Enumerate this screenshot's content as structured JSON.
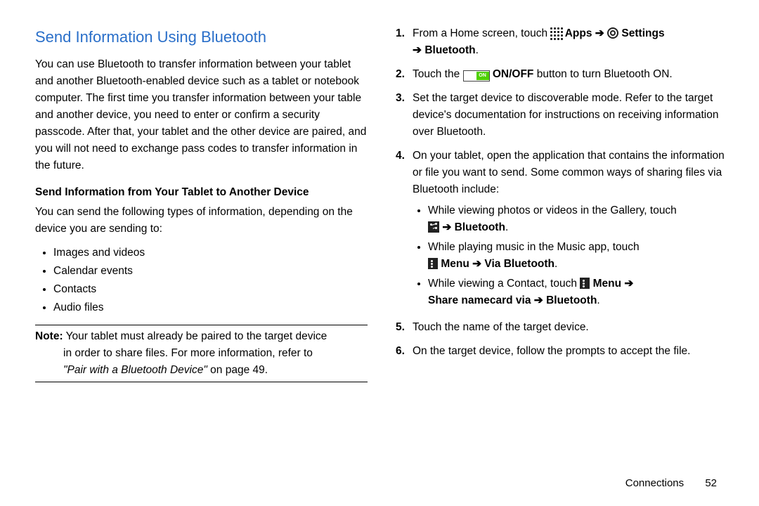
{
  "left": {
    "heading": "Send Information Using Bluetooth",
    "intro": "You can use Bluetooth to transfer information between your tablet and another Bluetooth-enabled device such as a tablet or notebook computer. The first time you transfer information between your table and another device, you need to enter or confirm a security passcode. After that, your tablet and the other device are paired, and you will not need to exchange pass codes to transfer information in the future.",
    "subhead": "Send Information from Your Tablet to Another Device",
    "youcan": "You can send the following types of information, depending on the device you are sending to:",
    "bullets": [
      "Images and videos",
      "Calendar events",
      "Contacts",
      "Audio files"
    ],
    "note_label": "Note:",
    "note_line1": " Your tablet must already be paired to the target device",
    "note_line2": "in order to share files. For more information, refer to",
    "note_link": "\"Pair with a Bluetooth Device\"",
    "note_page": " on page 49."
  },
  "right": {
    "step1_a": "From a Home screen, touch ",
    "step1_apps": " Apps ",
    "step1_settings": " Settings",
    "step1_bt": "Bluetooth",
    "step2_a": "Touch the ",
    "step2_b": " ON/OFF",
    "step2_c": " button to turn Bluetooth ON.",
    "step3": "Set the target device to discoverable mode. Refer to the target device's documentation for instructions on receiving information over Bluetooth.",
    "step4": "On your tablet, open the application that contains the information or file you want to send. Some common ways of sharing files via Bluetooth include:",
    "sb1_a": "While viewing photos or videos in the Gallery, touch ",
    "sb1_bt": "Bluetooth",
    "sb2_a": "While playing music in the Music app, touch ",
    "sb2_menu": " Menu ",
    "sb2_via": " Via Bluetooth",
    "sb3_a": "While viewing a Contact, touch ",
    "sb3_menu": "Menu ",
    "sb3_share": "Share namecard via ",
    "sb3_bt": " Bluetooth",
    "step5": "Touch the name of the target device.",
    "step6": "On the target device, follow the prompts to accept the file.",
    "toggle_on": "ON"
  },
  "footer": {
    "section": "Connections",
    "page": "52"
  },
  "arrow": "➔"
}
